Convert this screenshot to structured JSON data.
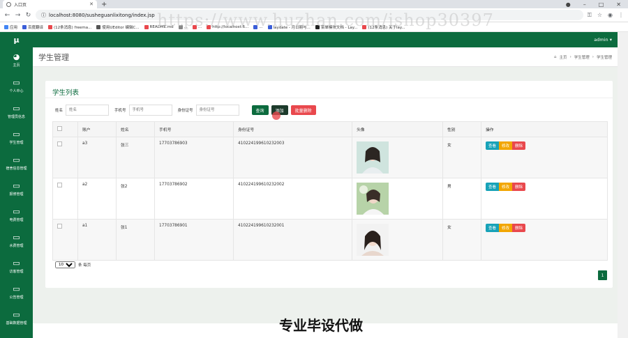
{
  "browser": {
    "tab_title": "入口页",
    "url": "localhost:8080/susheguanlixitong/index.jsp",
    "bookmarks": [
      "应用",
      "百度翻译",
      "(12条消息) freema...",
      "使用UEditor 编辑C...",
      "README.md",
      "...",
      "...",
      "http://localhost:6...",
      "...",
      "laydate - 月日期与...",
      "菜单模块文档 - Lay...",
      "(12条消息) 关于lay..."
    ]
  },
  "watermark": "https://www.huzhan.com/ishop30397",
  "header": {
    "logo": "μ",
    "user": "admin ▾"
  },
  "sidebar": {
    "items": [
      {
        "label": "主页",
        "icon": "dashboard-icon"
      },
      {
        "label": "个人中心",
        "icon": "monitor-icon"
      },
      {
        "label": "管理员信息",
        "icon": "monitor-icon"
      },
      {
        "label": "学生管理",
        "icon": "monitor-icon"
      },
      {
        "label": "宿舍信息管理",
        "icon": "monitor-icon"
      },
      {
        "label": "报修管理",
        "icon": "monitor-icon"
      },
      {
        "label": "电费管理",
        "icon": "monitor-icon"
      },
      {
        "label": "水费管理",
        "icon": "monitor-icon"
      },
      {
        "label": "访客管理",
        "icon": "monitor-icon"
      },
      {
        "label": "公告管理",
        "icon": "monitor-icon"
      },
      {
        "label": "基础数据管理",
        "icon": "monitor-icon"
      }
    ]
  },
  "page": {
    "title": "学生管理",
    "breadcrumb": [
      "主页",
      "学生管理",
      "学生管理"
    ]
  },
  "panel": {
    "title": "学生列表",
    "filters": [
      {
        "label": "姓名",
        "placeholder": "姓名"
      },
      {
        "label": "手机号",
        "placeholder": "手机号"
      },
      {
        "label": "身份证号",
        "placeholder": "身份证号"
      }
    ],
    "buttons": {
      "search": "查询",
      "add": "添加",
      "batch_delete": "批量删除"
    }
  },
  "table": {
    "columns": [
      "",
      "账户",
      "姓名",
      "手机号",
      "身份证号",
      "头像",
      "性别",
      "操作"
    ],
    "rows": [
      {
        "account": "a3",
        "name": "张三",
        "phone": "17703786903",
        "id_card": "410224199610232003",
        "gender": "女"
      },
      {
        "account": "a2",
        "name": "张2",
        "phone": "17703786902",
        "id_card": "410224199610232002",
        "gender": "男"
      },
      {
        "account": "a1",
        "name": "张1",
        "phone": "17703786901",
        "id_card": "410224199610232001",
        "gender": "女"
      }
    ],
    "actions": {
      "view": "查看",
      "edit": "修改",
      "delete": "删除"
    }
  },
  "pagination": {
    "page_size": "10",
    "per_page_label": "条 每页",
    "current_page": "1"
  },
  "caption": "专业毕设代做",
  "colors": {
    "primary": "#0c6b3e",
    "danger": "#e9484d",
    "info": "#17a2b8",
    "warning": "#f2a602"
  }
}
